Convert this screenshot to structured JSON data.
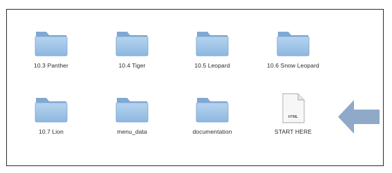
{
  "window": {
    "items": [
      {
        "label": "10.3 Panther",
        "icon": "folder-icon"
      },
      {
        "label": "10.4 Tiger",
        "icon": "folder-icon"
      },
      {
        "label": "10.5 Leopard",
        "icon": "folder-icon"
      },
      {
        "label": "10.6 Snow Leopard",
        "icon": "folder-icon"
      },
      {
        "label": "10.7 Lion",
        "icon": "folder-icon"
      },
      {
        "label": "menu_data",
        "icon": "folder-icon"
      },
      {
        "label": "documentation",
        "icon": "folder-icon"
      },
      {
        "label": "START HERE",
        "icon": "html-document-icon",
        "badge": "HTML"
      }
    ]
  },
  "annotation": {
    "icon": "arrow-left-icon",
    "color": "#8fa9c8"
  },
  "colors": {
    "folder_body": "#9dc3e6",
    "folder_tab": "#86b1d8",
    "border": "#2b2b2b"
  }
}
